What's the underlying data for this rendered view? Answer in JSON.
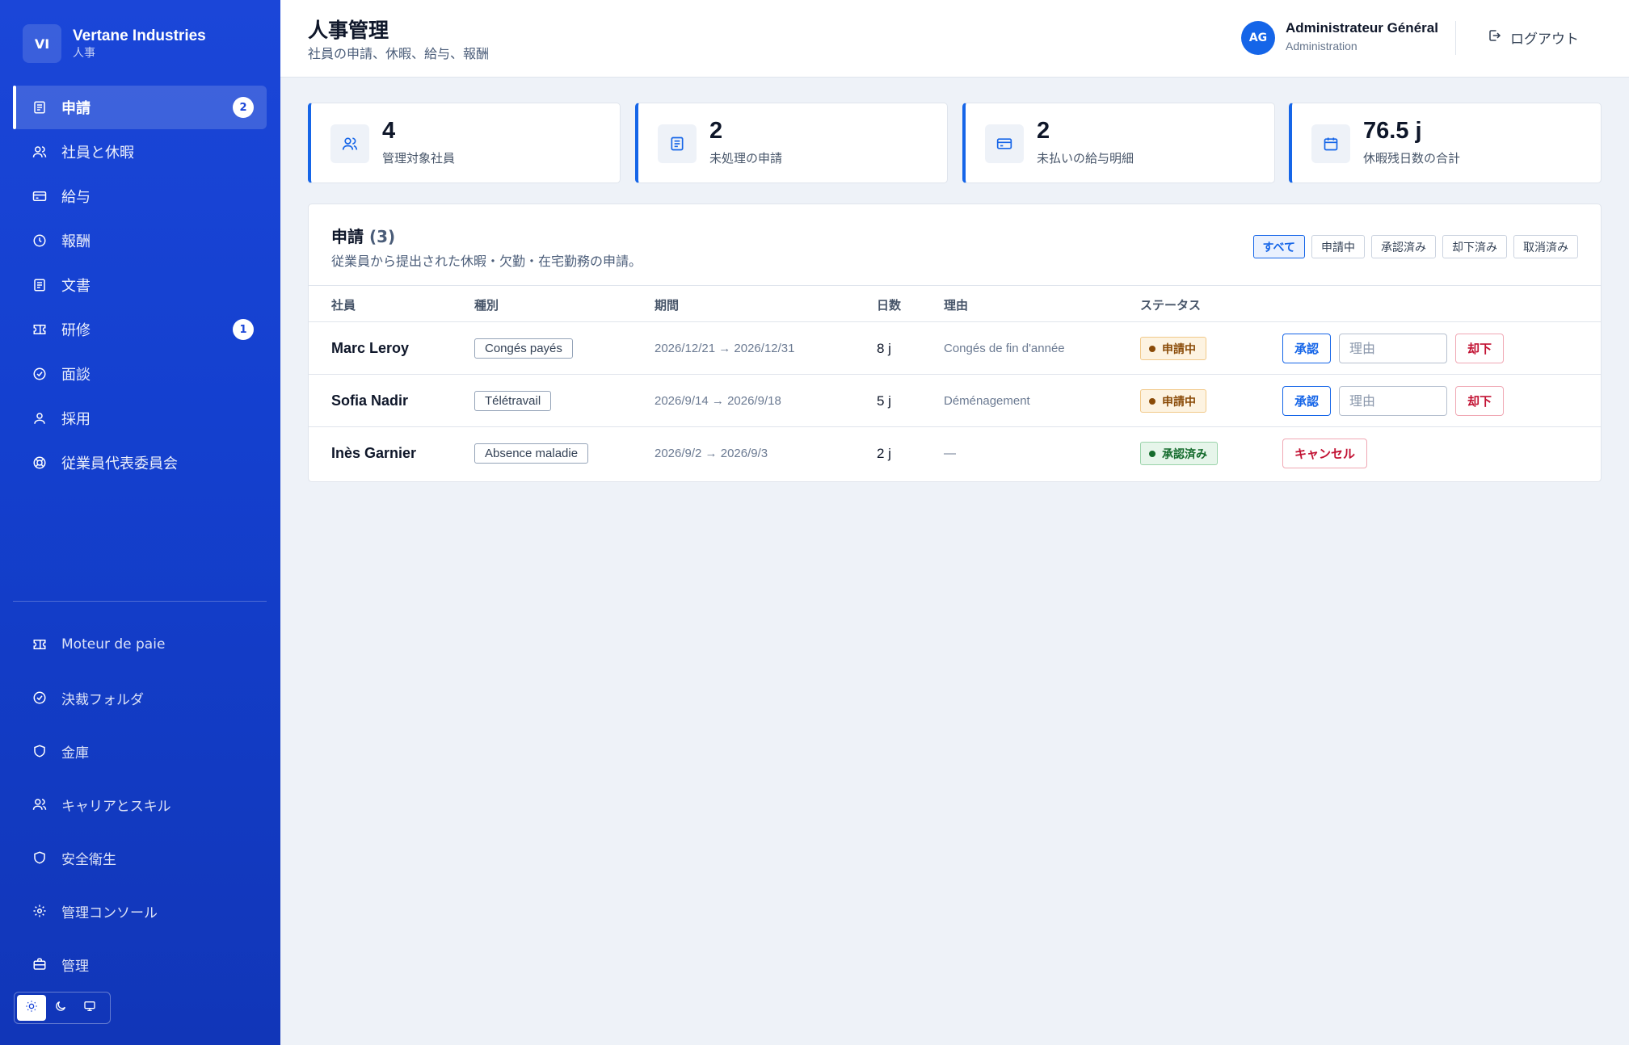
{
  "brand": {
    "initials": "VI",
    "name": "Vertane Industries",
    "subtitle": "人事"
  },
  "nav": {
    "items": [
      {
        "label": "申請",
        "badge": "2"
      },
      {
        "label": "社員と休暇"
      },
      {
        "label": "給与"
      },
      {
        "label": "報酬"
      },
      {
        "label": "文書"
      },
      {
        "label": "研修",
        "badge": "1"
      },
      {
        "label": "面談"
      },
      {
        "label": "採用"
      },
      {
        "label": "従業員代表委員会"
      }
    ],
    "secondary": [
      {
        "label": "Moteur de paie"
      },
      {
        "label": "決裁フォルダ"
      },
      {
        "label": "金庫"
      },
      {
        "label": "キャリアとスキル"
      },
      {
        "label": "安全衛生"
      },
      {
        "label": "管理コンソール"
      },
      {
        "label": "管理"
      }
    ]
  },
  "header": {
    "title": "人事管理",
    "subtitle": "社員の申請、休暇、給与、報酬",
    "user": {
      "initials": "AG",
      "name": "Administrateur Général",
      "role": "Administration"
    },
    "logout": "ログアウト"
  },
  "stats": [
    {
      "value": "4",
      "label": "管理対象社員",
      "icon": "users-icon"
    },
    {
      "value": "2",
      "label": "未処理の申請",
      "icon": "document-icon"
    },
    {
      "value": "2",
      "label": "未払いの給与明細",
      "icon": "card-icon"
    },
    {
      "value": "76.5 j",
      "label": "休暇残日数の合計",
      "icon": "calendar-icon"
    }
  ],
  "requests": {
    "title": "申請",
    "count": "(3)",
    "subtitle": "従業員から提出された休暇・欠勤・在宅勤務の申請。",
    "filters": [
      "すべて",
      "申請中",
      "承認済み",
      "却下済み",
      "取消済み"
    ],
    "active_filter": "すべて",
    "columns": [
      "社員",
      "種別",
      "期間",
      "日数",
      "理由",
      "ステータス"
    ],
    "rows": [
      {
        "employee": "Marc Leroy",
        "type": "Congés payés",
        "period": "2026/12/21 → 2026/12/31",
        "days": "8 j",
        "reason": "Congés de fin d'année",
        "status": "申請中",
        "approve": "承認",
        "reason_placeholder": "理由",
        "reject": "却下"
      },
      {
        "employee": "Sofia Nadir",
        "type": "Télétravail",
        "period": "2026/9/14 → 2026/9/18",
        "days": "5 j",
        "reason": "Déménagement",
        "status": "申請中",
        "approve": "承認",
        "reason_placeholder": "理由",
        "reject": "却下"
      },
      {
        "employee": "Inès Garnier",
        "type": "Absence maladie",
        "period": "2026/9/2 → 2026/9/3",
        "days": "2 j",
        "reason": "—",
        "status": "承認済み",
        "cancel": "キャンセル"
      }
    ]
  },
  "colors": {
    "accent": "#1565e8",
    "sidebar": "#1b46d8",
    "pending": "#8a4b08",
    "approved": "#146b2c",
    "danger": "#c21233"
  }
}
